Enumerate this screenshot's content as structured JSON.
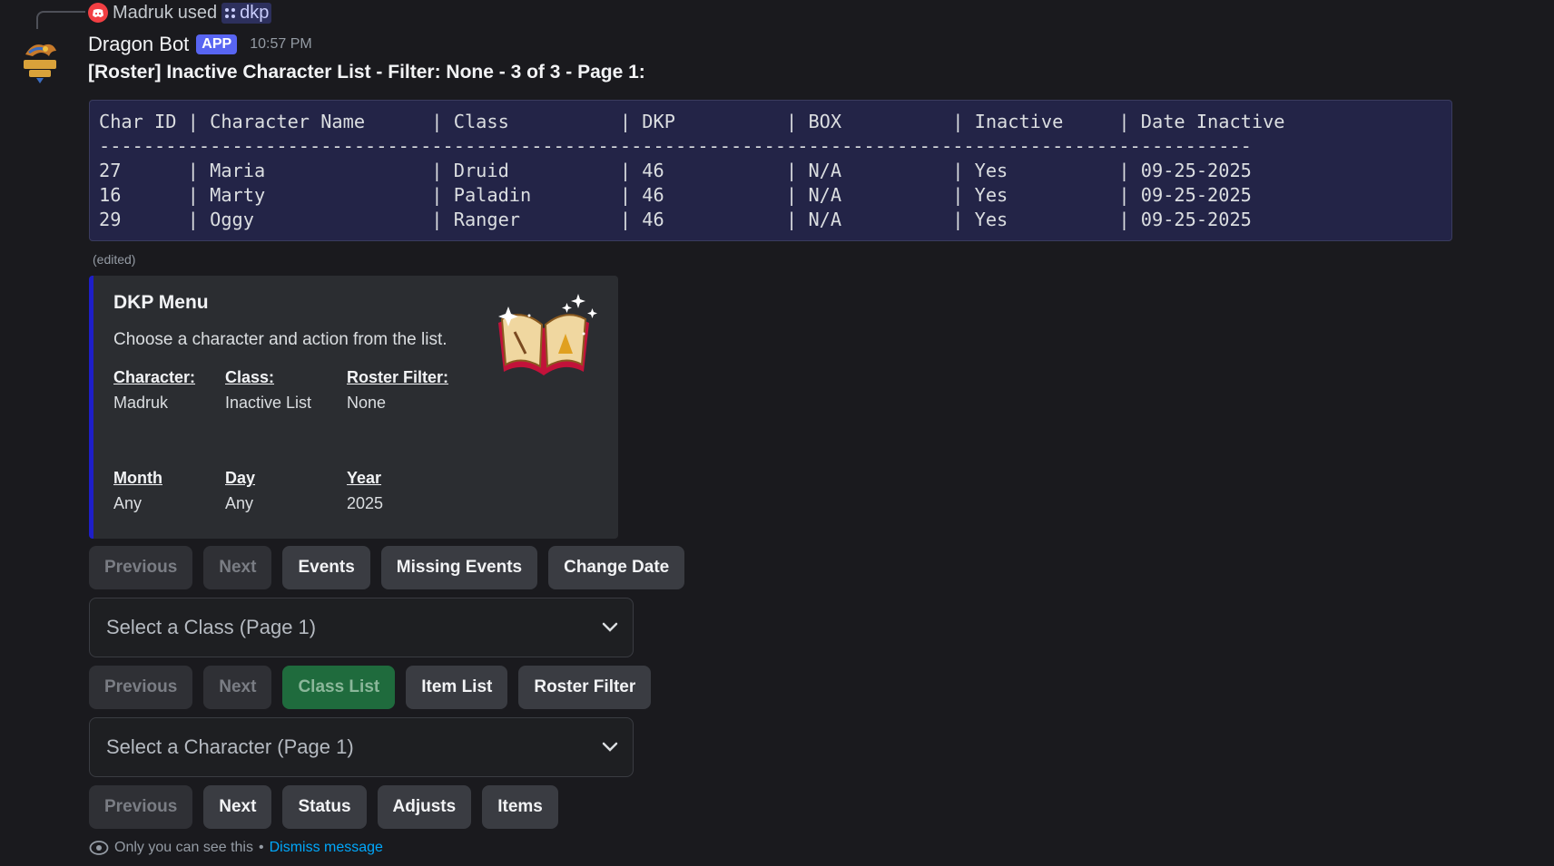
{
  "reply": {
    "user": "Madruk",
    "used_text": "used",
    "command": "dkp"
  },
  "message": {
    "bot_name": "Dragon Bot",
    "badge": "APP",
    "timestamp": "10:57 PM",
    "title": "[Roster] Inactive Character List - Filter: None - 3 of 3 - Page 1:",
    "edited_label": "(edited)"
  },
  "roster_table": {
    "header": "Char ID | Character Name      | Class          | DKP          | BOX          | Inactive     | Date Inactive",
    "divider": "--------------------------------------------------------------------------------------------------------",
    "rows": [
      "27      | Maria               | Druid          | 46           | N/A          | Yes          | 09-25-2025",
      "16      | Marty               | Paladin        | 46           | N/A          | Yes          | 09-25-2025",
      "29      | Oggy                | Ranger         | 46           | N/A          | Yes          | 09-25-2025"
    ]
  },
  "embed": {
    "accent_color": "#1e1ec8",
    "title": "DKP Menu",
    "description": "Choose a character and action from the list.",
    "fields": [
      {
        "name": "Character:",
        "value": "Madruk"
      },
      {
        "name": "Class:",
        "value": "Inactive List"
      },
      {
        "name": "Roster Filter:",
        "value": "None"
      },
      {
        "name": "Month",
        "value": "Any"
      },
      {
        "name": "Day",
        "value": "Any"
      },
      {
        "name": "Year",
        "value": "2025"
      }
    ],
    "thumbnail_icon": "spellbook-icon"
  },
  "button_rows": [
    [
      "Previous",
      "Next",
      "Events",
      "Missing Events",
      "Change Date"
    ],
    [
      "Previous",
      "Next",
      "Class List",
      "Item List",
      "Roster Filter"
    ],
    [
      "Previous",
      "Next",
      "Status",
      "Adjusts",
      "Items"
    ]
  ],
  "selects": {
    "class_placeholder": "Select a Class (Page 1)",
    "character_placeholder": "Select a Character (Page 1)"
  },
  "footer": {
    "notice": "Only you can see this",
    "separator": "•",
    "dismiss": "Dismiss message"
  },
  "colors": {
    "brand": "#5865f2",
    "success_button": "#1f6b3d",
    "link": "#00a8fc"
  }
}
